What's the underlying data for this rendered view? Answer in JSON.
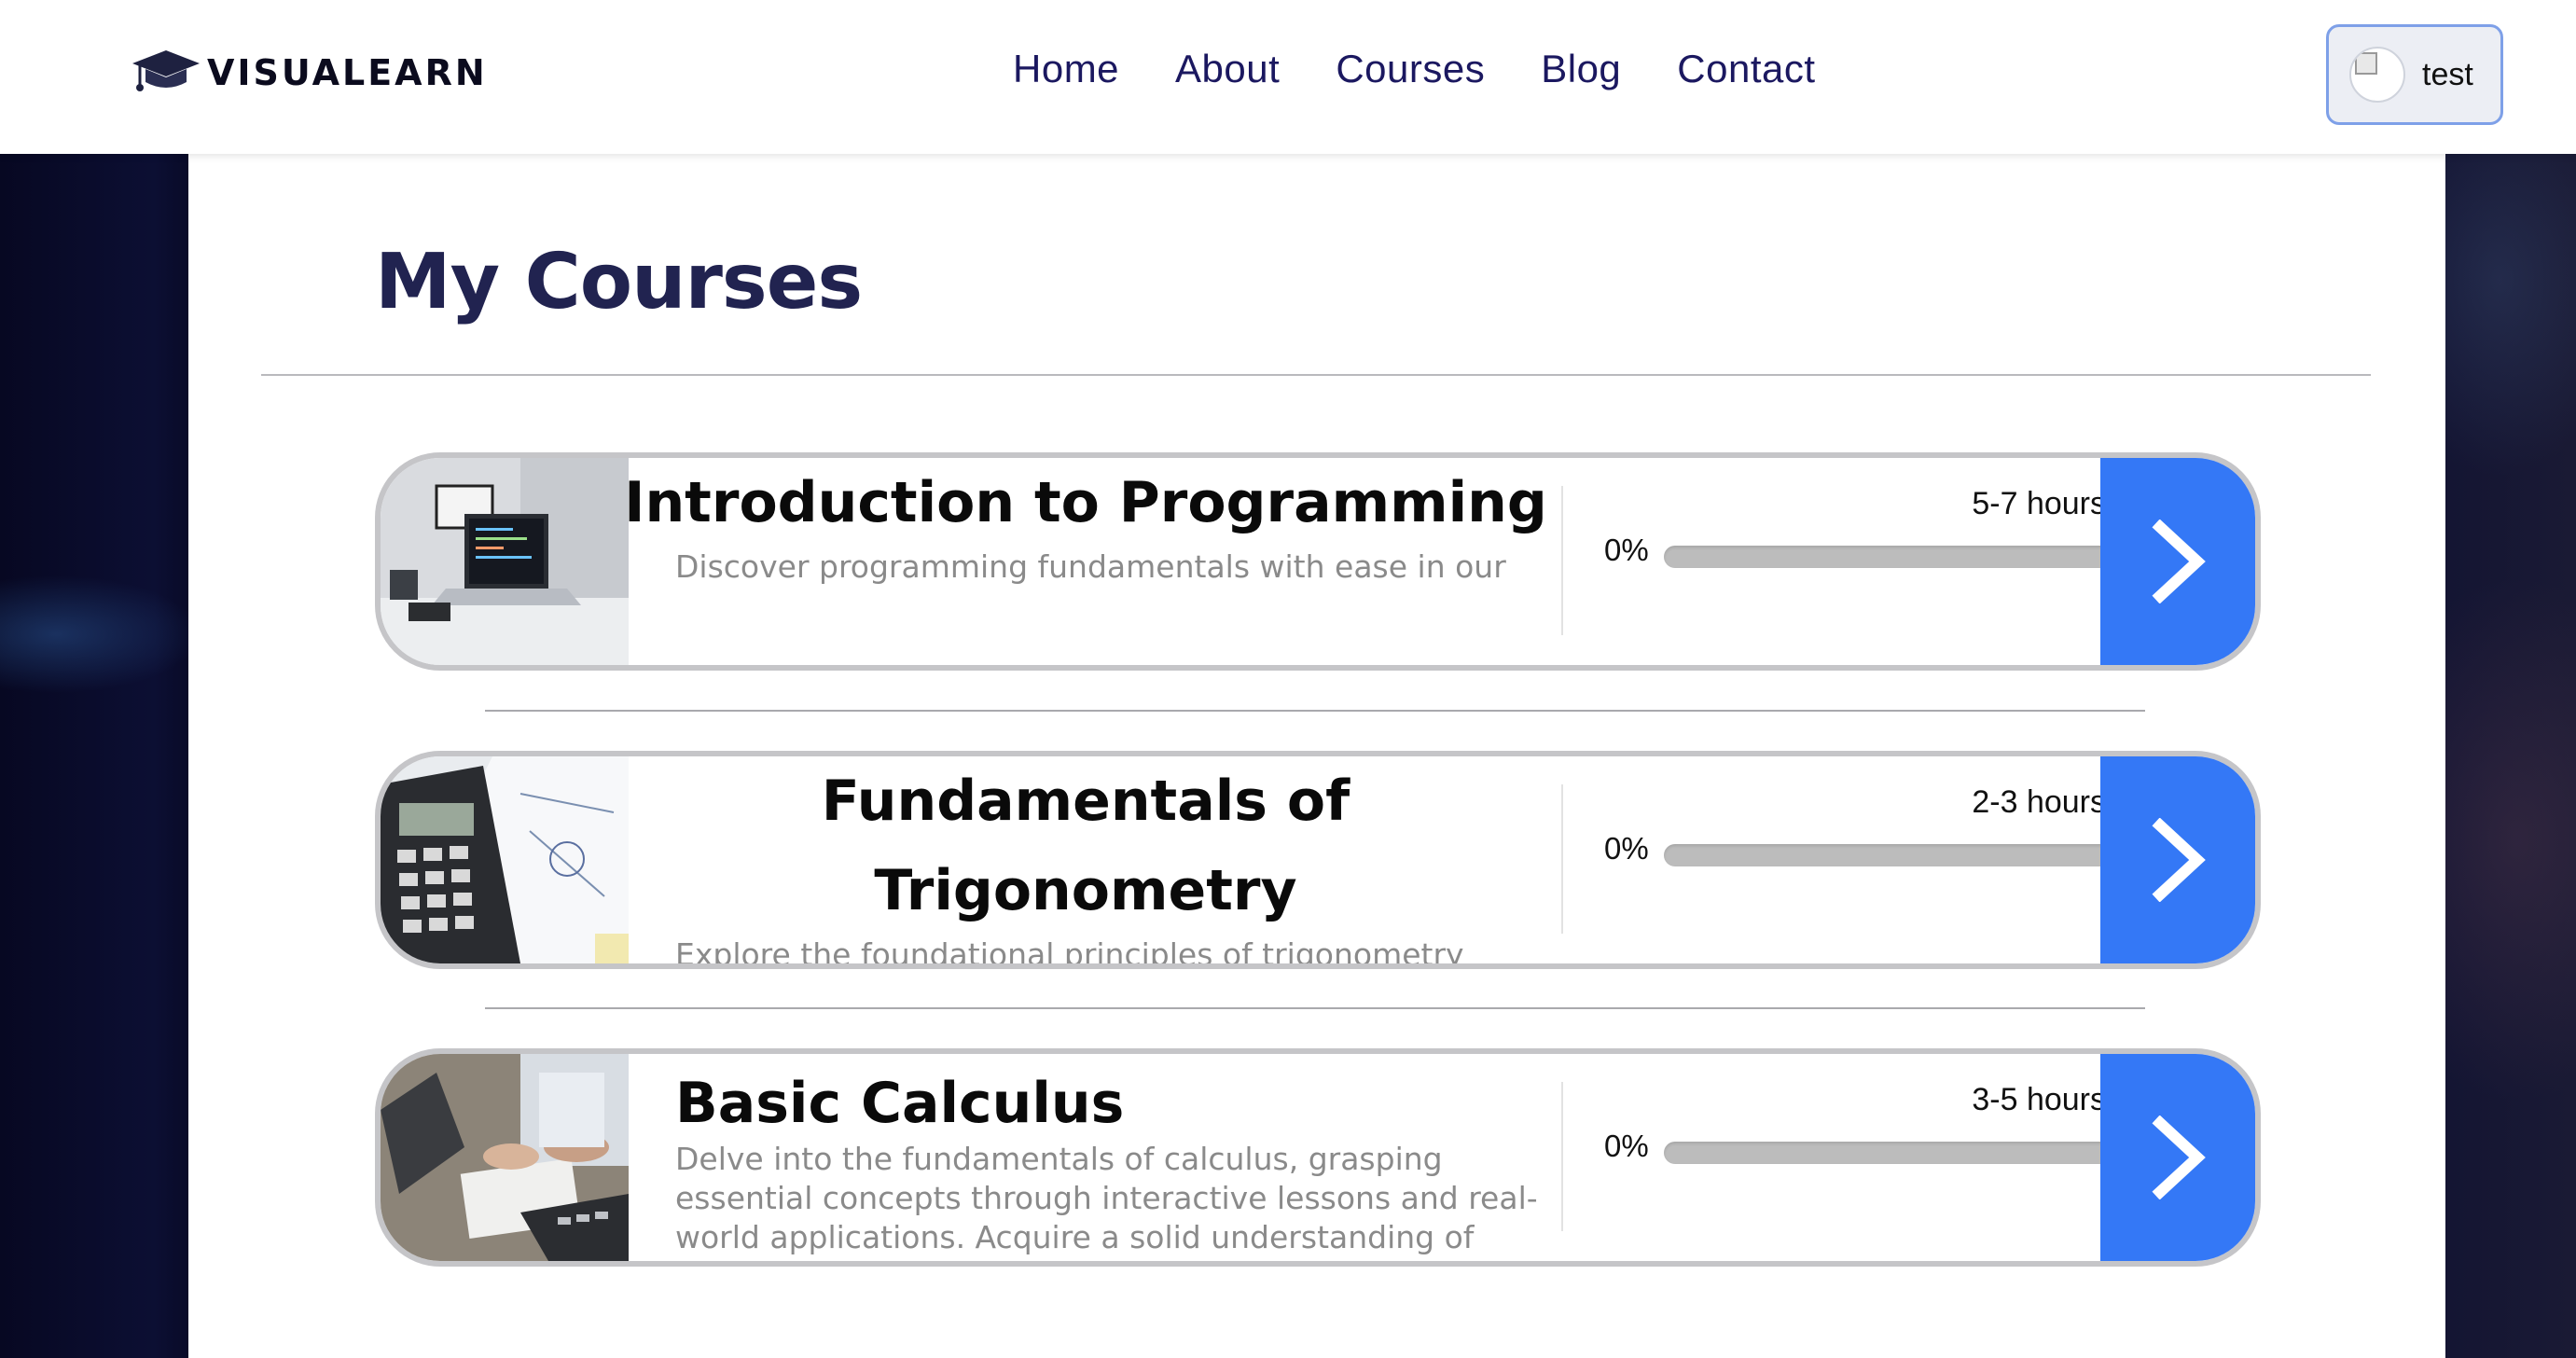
{
  "brand": {
    "name": "VISUALEARN",
    "icon": "graduation-cap-icon"
  },
  "nav": {
    "items": [
      {
        "label": "Home"
      },
      {
        "label": "About"
      },
      {
        "label": "Courses"
      },
      {
        "label": "Blog"
      },
      {
        "label": "Contact"
      }
    ]
  },
  "user": {
    "name": "test",
    "icon": "broken-image-icon"
  },
  "page": {
    "title": "My Courses"
  },
  "courses": [
    {
      "title": "Introduction to Programming",
      "description": "Discover programming fundamentals with ease in our",
      "duration": "5-7 hours",
      "progress_label": "0%",
      "progress": 0,
      "image": "laptop-desk-image"
    },
    {
      "title": "Fundamentals of Trigonometry",
      "description": "Explore the foundational principles of trigonometry",
      "duration": "2-3 hours",
      "progress_label": "0%",
      "progress": 0,
      "image": "calculator-notes-image"
    },
    {
      "title": "Basic Calculus",
      "description": "Delve into the fundamentals of calculus, grasping essential concepts through interactive lessons and real-world applications. Acquire a solid understanding of",
      "duration": "3-5 hours",
      "progress_label": "0%",
      "progress": 0,
      "image": "students-laptop-image"
    }
  ],
  "colors": {
    "accent": "#3478f6",
    "title": "#212350",
    "nav_text": "#1b1860"
  },
  "icons": {
    "go": "chevron-right-icon"
  }
}
